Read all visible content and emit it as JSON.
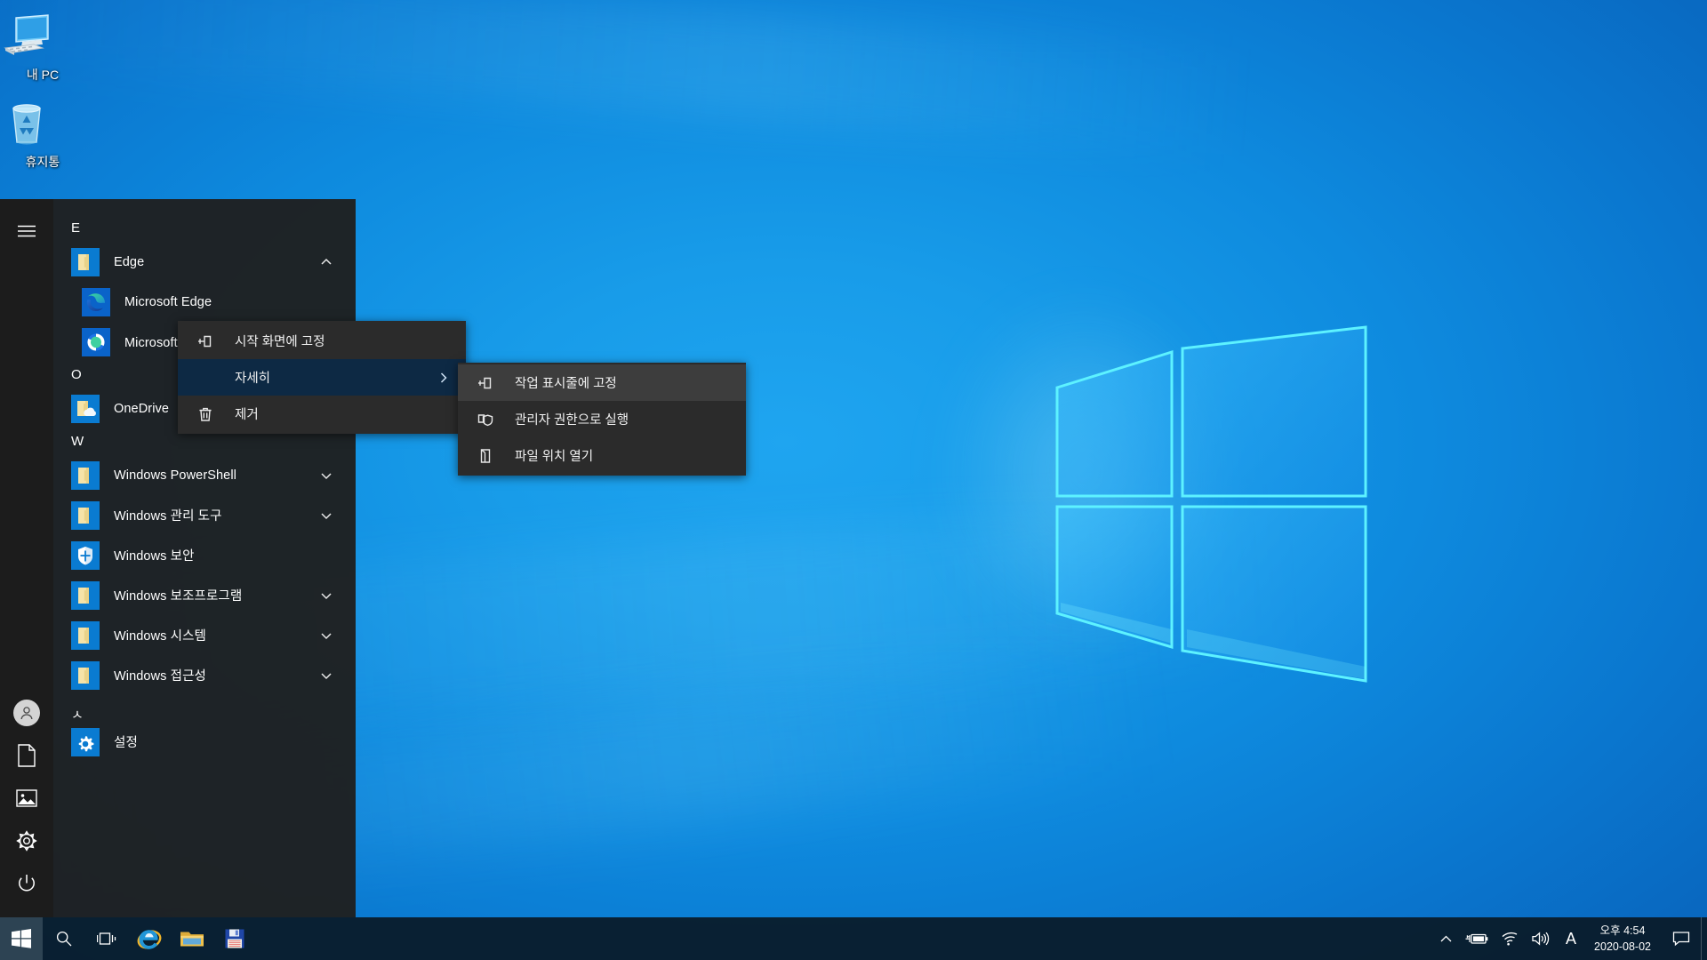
{
  "desktop": {
    "icons": [
      {
        "name": "my-pc",
        "label": "내 PC",
        "icon": "computer-icon"
      },
      {
        "name": "recycle-bin",
        "label": "휴지통",
        "icon": "recycle-bin-icon"
      }
    ],
    "wallpaper_colors": {
      "sky_light": "#1fa5f0",
      "sky_mid": "#0e8ade",
      "sky_deep": "#0860b8",
      "logo_edge": "#4ef0ff",
      "logo_fill": "#2bb4f5"
    }
  },
  "start_menu": {
    "rail": [
      {
        "name": "hamburger",
        "icon": "hamburger-icon",
        "label": ""
      },
      {
        "name": "user-account",
        "icon": "user-account-icon",
        "label": ""
      },
      {
        "name": "documents",
        "icon": "document-icon",
        "label": ""
      },
      {
        "name": "pictures",
        "icon": "pictures-icon",
        "label": ""
      },
      {
        "name": "settings",
        "icon": "gear-icon",
        "label": ""
      },
      {
        "name": "power",
        "icon": "power-icon",
        "label": ""
      }
    ],
    "groups": [
      {
        "letter": "E",
        "items": [
          {
            "label": "Edge",
            "icon": "folder-icon",
            "expanded": true,
            "chevron": "up",
            "sub": false
          },
          {
            "label": "Microsoft Edge",
            "icon": "edge-icon",
            "chevron": "",
            "sub": true
          },
          {
            "label": "Microsoft Edge 업데이트",
            "icon": "edge-update-icon",
            "chevron": "",
            "sub": true
          }
        ]
      },
      {
        "letter": "O",
        "items": [
          {
            "label": "OneDrive",
            "icon": "onedrive-folder-icon",
            "chevron": "",
            "sub": false
          }
        ]
      },
      {
        "letter": "W",
        "items": [
          {
            "label": "Windows PowerShell",
            "icon": "folder-icon",
            "chevron": "down",
            "sub": false
          },
          {
            "label": "Windows 관리 도구",
            "icon": "folder-icon",
            "chevron": "down",
            "sub": false
          },
          {
            "label": "Windows 보안",
            "icon": "shield-icon",
            "chevron": "",
            "sub": false
          },
          {
            "label": "Windows 보조프로그램",
            "icon": "folder-icon",
            "chevron": "down",
            "sub": false
          },
          {
            "label": "Windows 시스템",
            "icon": "folder-icon",
            "chevron": "down",
            "sub": false
          },
          {
            "label": "Windows 접근성",
            "icon": "folder-icon",
            "chevron": "down",
            "sub": false
          }
        ]
      },
      {
        "letter": "ㅅ",
        "items": [
          {
            "label": "설정",
            "icon": "gear-tile-icon",
            "chevron": "",
            "sub": false
          }
        ]
      }
    ]
  },
  "context_menu": {
    "items": [
      {
        "label": "시작 화면에 고정",
        "icon": "pin-icon",
        "state": "normal",
        "has_arrow": false
      },
      {
        "label": "자세히",
        "icon": "",
        "state": "selected",
        "has_arrow": true
      },
      {
        "label": "제거",
        "icon": "trash-icon",
        "state": "normal",
        "has_arrow": false
      }
    ]
  },
  "submenu": {
    "items": [
      {
        "label": "작업 표시줄에 고정",
        "icon": "pin-icon",
        "state": "highlighted"
      },
      {
        "label": "관리자 권한으로 실행",
        "icon": "shield-run-icon",
        "state": "normal"
      },
      {
        "label": "파일 위치 열기",
        "icon": "open-folder-icon",
        "state": "normal"
      }
    ]
  },
  "taskbar": {
    "start_button": {
      "name": "start-button",
      "icon": "windows-logo-icon"
    },
    "buttons": [
      {
        "name": "search",
        "icon": "search-icon"
      },
      {
        "name": "task-view",
        "icon": "task-view-icon"
      },
      {
        "name": "internet-explorer",
        "icon": "internet-explorer-icon"
      },
      {
        "name": "file-explorer",
        "icon": "file-explorer-icon"
      },
      {
        "name": "save-app",
        "icon": "floppy-disk-icon"
      }
    ],
    "tray": [
      {
        "name": "show-hidden-icons",
        "icon": "chevron-up-icon"
      },
      {
        "name": "battery",
        "icon": "battery-charging-icon"
      },
      {
        "name": "network",
        "icon": "wifi-icon"
      },
      {
        "name": "volume",
        "icon": "speaker-icon"
      }
    ],
    "ime_indicator": "A",
    "clock": {
      "time": "오후 4:54",
      "date": "2020-08-02"
    },
    "action_center": {
      "name": "action-center",
      "icon": "speech-bubble-icon"
    }
  }
}
